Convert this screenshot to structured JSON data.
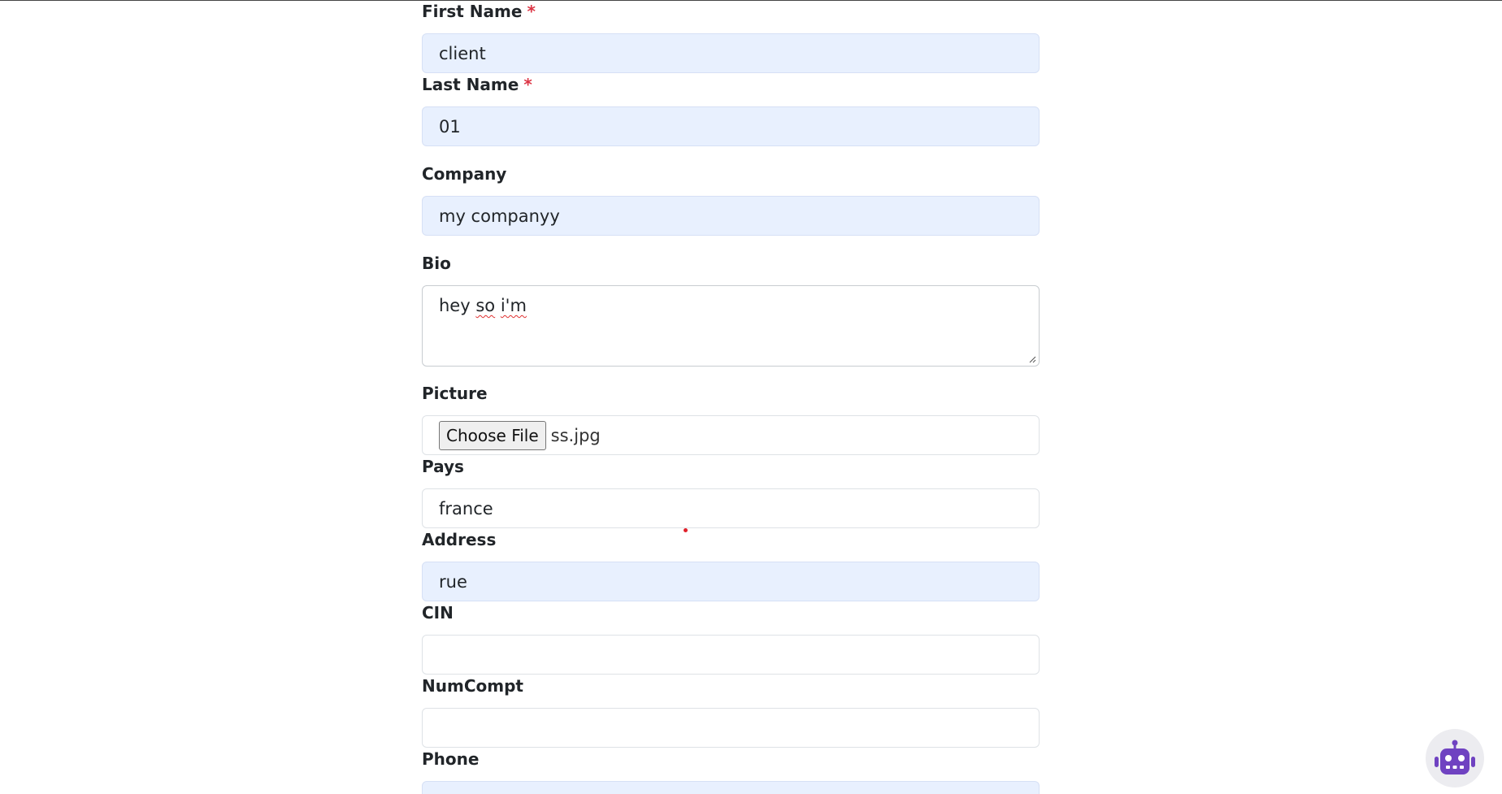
{
  "form": {
    "first_name": {
      "label": "First Name",
      "required_mark": "*",
      "value": "client"
    },
    "last_name": {
      "label": "Last Name",
      "required_mark": "*",
      "value": "01"
    },
    "company": {
      "label": "Company",
      "value": "my companyy"
    },
    "bio": {
      "label": "Bio",
      "value_words": [
        "hey",
        "so",
        "i'm"
      ]
    },
    "picture": {
      "label": "Picture",
      "button_label": "Choose File",
      "file_name": "ss.jpg"
    },
    "pays": {
      "label": "Pays",
      "value": "france"
    },
    "address": {
      "label": "Address",
      "value": "rue"
    },
    "cin": {
      "label": "CIN",
      "value": ""
    },
    "numcompt": {
      "label": "NumCompt",
      "value": ""
    },
    "phone": {
      "label": "Phone",
      "value": ""
    }
  },
  "colors": {
    "autofill_bg": "#e8f0fe",
    "required": "#dc3545",
    "bot_accent": "#6f42c1"
  },
  "icons": {
    "chatbot": "robot-icon"
  }
}
